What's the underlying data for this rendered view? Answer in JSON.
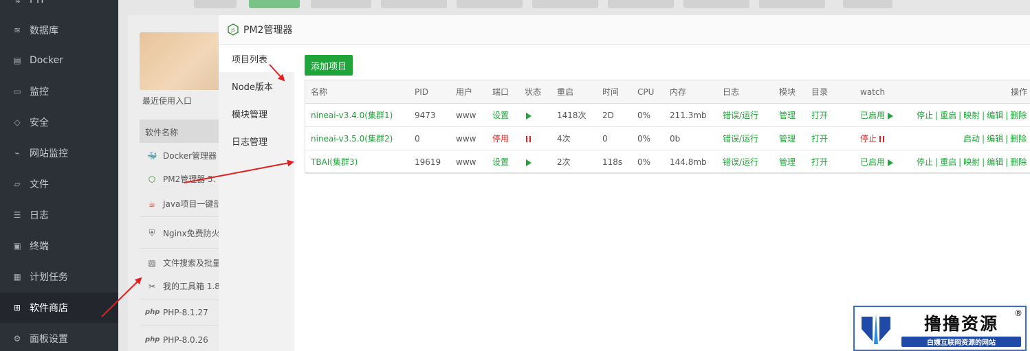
{
  "sidebar": {
    "items": [
      {
        "icon": "ftp-icon",
        "label": "FTP"
      },
      {
        "icon": "database-icon",
        "label": "数据库"
      },
      {
        "icon": "docker-icon",
        "label": "Docker"
      },
      {
        "icon": "monitor-icon",
        "label": "监控"
      },
      {
        "icon": "shield-icon",
        "label": "安全"
      },
      {
        "icon": "site-monitor-icon",
        "label": "网站监控"
      },
      {
        "icon": "folder-icon",
        "label": "文件"
      },
      {
        "icon": "log-icon",
        "label": "日志"
      },
      {
        "icon": "terminal-icon",
        "label": "终端"
      },
      {
        "icon": "calendar-icon",
        "label": "计划任务"
      },
      {
        "icon": "apps-icon",
        "label": "软件商店",
        "active": true
      },
      {
        "icon": "gear-icon",
        "label": "面板设置"
      }
    ]
  },
  "background": {
    "recent_label": "最近使用入口",
    "software_header": "软件名称",
    "software_list": [
      {
        "icon": "docker-icon",
        "label": "Docker管理器"
      },
      {
        "icon": "nodejs-icon",
        "label": "PM2管理器 5."
      },
      {
        "icon": "java-icon",
        "label": "Java项目一键部"
      },
      {
        "icon": "waf-icon",
        "label": "Nginx免费防火"
      },
      {
        "icon": "image-icon",
        "label": "文件搜索及批量"
      },
      {
        "icon": "tools-icon",
        "label": "我的工具箱 1.8"
      },
      {
        "icon": "php-icon",
        "label": "PHP-8.1.27"
      },
      {
        "icon": "php-icon",
        "label": "PHP-8.0.26"
      }
    ]
  },
  "modal": {
    "title": "PM2管理器",
    "nav": [
      "项目列表",
      "Node版本",
      "模块管理",
      "日志管理"
    ],
    "add_button": "添加项目",
    "columns": [
      "名称",
      "PID",
      "用户",
      "端口",
      "状态",
      "重启",
      "时间",
      "CPU",
      "内存",
      "日志",
      "模块",
      "目录",
      "watch",
      "操作"
    ],
    "rows": [
      {
        "name": "nineai-v3.4.0(集群1)",
        "pid": "9473",
        "user": "www",
        "port": "设置",
        "port_state": "ok",
        "status": "running",
        "restart": "1418次",
        "time": "2D",
        "cpu": "0%",
        "mem": "211.3mb",
        "log": "错误/运行",
        "module": "管理",
        "dir": "打开",
        "watch": "已启用",
        "watch_state": "on",
        "actions": [
          "停止",
          "重启",
          "映射",
          "编辑",
          "删除"
        ]
      },
      {
        "name": "nineai-v3.5.0(集群2)",
        "pid": "0",
        "user": "www",
        "port": "停用",
        "port_state": "off",
        "status": "stopped",
        "restart": "4次",
        "time": "0",
        "cpu": "0%",
        "mem": "0b",
        "log": "错误/运行",
        "module": "管理",
        "dir": "打开",
        "watch": "停止",
        "watch_state": "off",
        "actions": [
          "启动",
          "编辑",
          "删除"
        ]
      },
      {
        "name": "TBAI(集群3)",
        "pid": "19619",
        "user": "www",
        "port": "设置",
        "port_state": "ok",
        "status": "running",
        "restart": "2次",
        "time": "118s",
        "cpu": "0%",
        "mem": "144.8mb",
        "log": "错误/运行",
        "module": "管理",
        "dir": "打开",
        "watch": "已启用",
        "watch_state": "on",
        "actions": [
          "停止",
          "重启",
          "映射",
          "编辑",
          "删除"
        ]
      }
    ]
  },
  "watermark": {
    "name": "撸撸资源",
    "slogan": "白嫖互联网资源的网站",
    "reg": "®"
  },
  "colors": {
    "accent": "#20a53a",
    "danger": "#e02020",
    "sidebar": "#2c3138",
    "arrow": "#e02020"
  }
}
